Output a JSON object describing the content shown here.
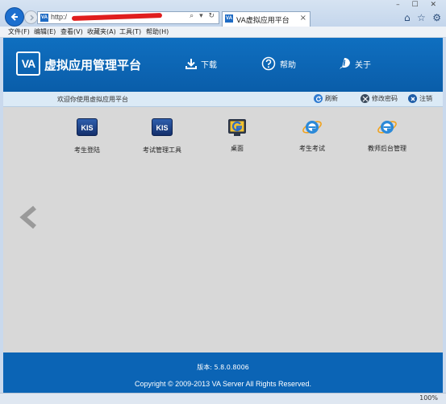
{
  "browser": {
    "address_prefix": "http:/",
    "tab_title": "VA虚拟应用平台",
    "favicon_text": "VA",
    "address_tools": "⌕ ▾ ↻",
    "window_controls": "– ☐ ✕",
    "tab_close": "×",
    "menu": [
      {
        "label": "文件(F)"
      },
      {
        "label": "编辑(E)"
      },
      {
        "label": "查看(V)"
      },
      {
        "label": "收藏夹(A)"
      },
      {
        "label": "工具(T)"
      },
      {
        "label": "帮助(H)"
      }
    ],
    "toolbar_icons": [
      "home-icon",
      "star-icon",
      "gear-icon"
    ],
    "toolbar_glyphs": {
      "home": "⌂",
      "favorites": "☆",
      "tools": "⚙"
    },
    "zoom": "100%"
  },
  "header": {
    "logo_text": "VA",
    "title": "虚拟应用管理平台",
    "nav": [
      {
        "label": "下载",
        "icon": "download-icon"
      },
      {
        "label": "帮助",
        "icon": "help-icon"
      },
      {
        "label": "关于",
        "icon": "info-icon"
      }
    ]
  },
  "infobar": {
    "welcome": "欢迎你使用虚拟应用平台",
    "actions": [
      {
        "label": "刷新",
        "icon": "refresh-icon",
        "color": "#2f7bd1"
      },
      {
        "label": "修改密码",
        "icon": "wrench-icon",
        "color": "#3a4a5c"
      },
      {
        "label": "注销",
        "icon": "close-icon",
        "color": "#1f5ea8"
      }
    ]
  },
  "apps": [
    {
      "label": "考生登陆",
      "icon": "kis-icon",
      "icon_text": "KIS"
    },
    {
      "label": "考试管理工具",
      "icon": "kis-icon",
      "icon_text": "KIS"
    },
    {
      "label": "桌面",
      "icon": "desktop-icon"
    },
    {
      "label": "考生考试",
      "icon": "ie-icon"
    },
    {
      "label": "教师后台管理",
      "icon": "ie-icon"
    }
  ],
  "footer": {
    "version": "版本: 5.8.0.8006",
    "copyright": "Copyright © 2009-2013 VA Server All Rights Reserved."
  },
  "colors": {
    "header_blue": "#0b64b5",
    "infobar_bg": "#dbeaf6",
    "content_bg": "#d8d8d8"
  }
}
